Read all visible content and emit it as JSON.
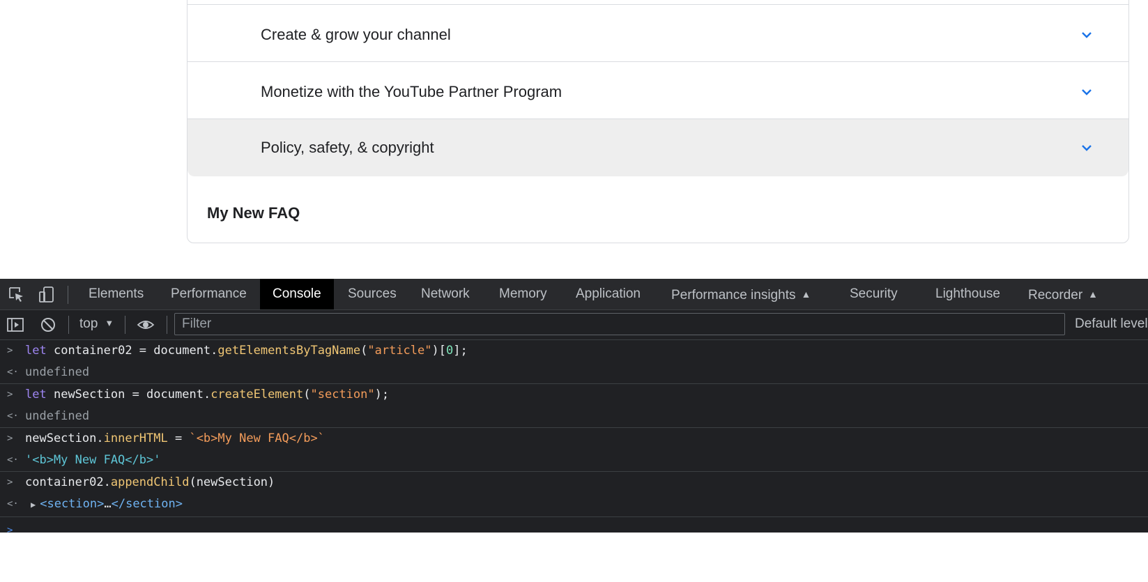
{
  "page": {
    "accordion": [
      {
        "label": "Create & grow your channel"
      },
      {
        "label": "Monetize with the YouTube Partner Program"
      },
      {
        "label": "Policy, safety, & copyright"
      }
    ],
    "new_faq": "My New FAQ"
  },
  "devtools": {
    "tabs": [
      "Elements",
      "Performance",
      "Console",
      "Sources",
      "Network",
      "Memory",
      "Application",
      "Performance insights",
      "Security",
      "Lighthouse",
      "Recorder"
    ],
    "active_tab": "Console",
    "context": "top",
    "filter_placeholder": "Filter",
    "levels": "Default levels",
    "console": [
      {
        "input": {
          "kw": "let",
          "var": "container02",
          "eq": " = ",
          "obj": "document",
          "dot": ".",
          "fn": "getElementsByTagName",
          "open": "(",
          "str": "\"article\"",
          "close": ")[",
          "num": "0",
          "end": "];"
        },
        "result": "undefined"
      },
      {
        "input": {
          "kw": "let",
          "var": "newSection",
          "eq": " = ",
          "obj": "document",
          "dot": ".",
          "fn": "createElement",
          "open": "(",
          "str": "\"section\"",
          "end": ");"
        },
        "result": "undefined"
      },
      {
        "input": {
          "obj": "newSection",
          "dot": ".",
          "prop": "innerHTML",
          "eq": " = ",
          "str": "`<b>My New FAQ</b>`"
        },
        "result": "'<b>My New FAQ</b>'"
      },
      {
        "input": {
          "obj": "container02",
          "dot": ".",
          "fn": "appendChild",
          "open": "(",
          "arg": "newSection",
          "end": ")"
        },
        "result_open": "<section>",
        "result_ellipsis": "…",
        "result_close": "</section>"
      }
    ]
  },
  "colors": {
    "accent_chevron": "#1a73e8",
    "devtools_bg": "#202124"
  }
}
